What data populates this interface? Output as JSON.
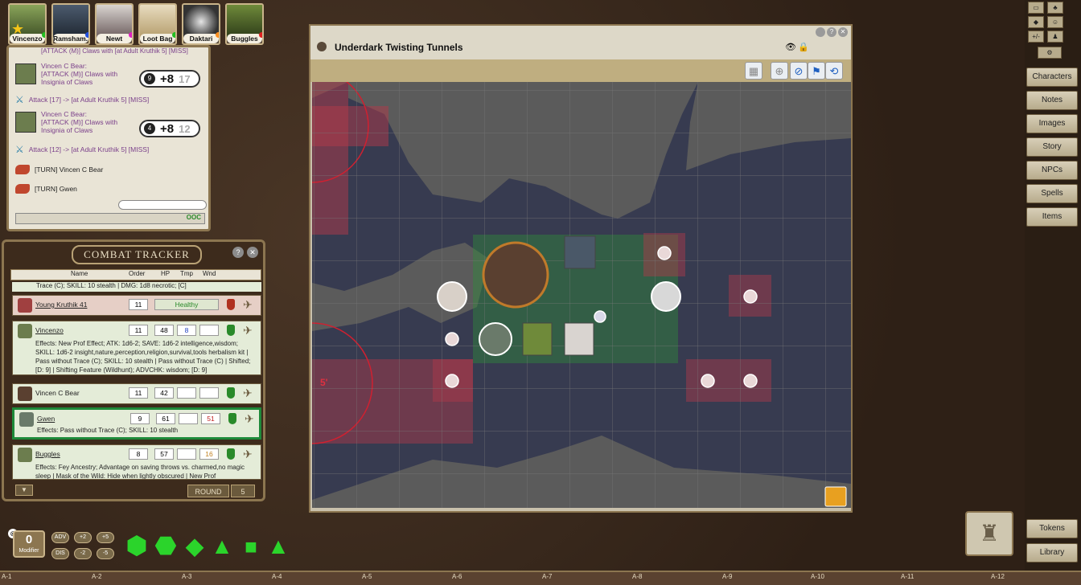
{
  "portraits": [
    {
      "name": "Vincenzo",
      "dot": "#22c022",
      "star": true
    },
    {
      "name": "Ramsham...",
      "dot": "#2050e0"
    },
    {
      "name": "Newt",
      "dot": "#e020c0"
    },
    {
      "name": "Loot Bag",
      "dot": "#22c022"
    },
    {
      "name": "Daktari",
      "dot": "#ff9020"
    },
    {
      "name": "Buggles",
      "dot": "#e02020"
    }
  ],
  "chat": {
    "top_partial": "[ATTACK (M)] Claws with [at Adult Kruthik 5] [MISS]",
    "entries": [
      {
        "type": "roll",
        "text1": "Vincen C Bear:",
        "text2": "[ATTACK (M)] Claws with",
        "text3": "Insignia of Claws",
        "die": "9",
        "total": "+8",
        "raw": "17"
      },
      {
        "type": "attack",
        "text": "Attack [17] -> [at Adult Kruthik 5] [MISS]"
      },
      {
        "type": "roll",
        "text1": "Vincen C Bear:",
        "text2": "[ATTACK (M)] Claws with",
        "text3": "Insignia of Claws",
        "die": "4",
        "total": "+8",
        "raw": "12"
      },
      {
        "type": "attack",
        "text": "Attack [12] -> [at Adult Kruthik 5] [MISS]"
      },
      {
        "type": "turn",
        "text": "[TURN] Vincen C Bear"
      },
      {
        "type": "turn",
        "text": "[TURN] Gwen"
      }
    ],
    "ooc": "OOC"
  },
  "combat_tracker": {
    "title": "COMBAT TRACKER",
    "headers": {
      "name": "Name",
      "order": "Order",
      "hp": "HP",
      "tmp": "Tmp",
      "wnd": "Wnd"
    },
    "top_partial": "Trace (C); SKILL: 10 stealth | DMG: 1d8 necrotic; [C]",
    "entries": [
      {
        "name": "Young Kruthik 41",
        "order": "11",
        "status": "Healthy",
        "bg": "#e6cfc6"
      },
      {
        "name": "Vincenzo",
        "order": "11",
        "hp": "48",
        "tmp": "8",
        "wnd": "",
        "bg": "#e4ecd8",
        "effects": "Effects: New Prof Effect; ATK: 1d6-2; SAVE: 1d6-2 intelligence,wisdom; SKILL: 1d6-2 insight,nature,perception,religion,survival,tools herbalism kit | Pass without Trace (C); SKILL: 10 stealth | Pass without Trace (C) | Shifted; [D: 9] | Shifting Feature (Wildhunt); ADVCHK: wisdom; [D: 9]"
      },
      {
        "name": "Vincen C Bear",
        "order": "11",
        "hp": "42",
        "tmp": "",
        "wnd": "",
        "bg": "#e4ecd8"
      },
      {
        "name": "Gwen",
        "order": "9",
        "hp": "61",
        "tmp": "",
        "wnd": "51",
        "bg": "#e4ecd8",
        "effects": "Effects: Pass without Trace (C); SKILL: 10 stealth"
      },
      {
        "name": "Buggles",
        "order": "8",
        "hp": "57",
        "tmp": "",
        "wnd": "16",
        "bg": "#e4ecd8",
        "effects": "Effects: Fey Ancestry; Advantage on saving throws vs. charmed,no magic sleep | Mask of the Wild: Hide when lightly obscured | New Prof"
      }
    ],
    "round_label": "ROUND",
    "round_value": "5"
  },
  "map": {
    "title": "Underdark Twisting Tunnels",
    "range_label": "5'"
  },
  "sidebar": {
    "top_buttons": [
      "+/-",
      "⚙"
    ],
    "buttons": [
      "Characters",
      "Notes",
      "Images",
      "Story",
      "NPCs",
      "Spells",
      "Items"
    ],
    "bottom_buttons": [
      "Tokens",
      "Library"
    ]
  },
  "modifier": {
    "value": "0",
    "label": "Modifier",
    "buttons": [
      "ADV",
      "+2",
      "+5",
      "DIS",
      "-2",
      "-5"
    ]
  },
  "dice": [
    "d20",
    "d12",
    "d10",
    "d8",
    "d6",
    "d4"
  ],
  "hotkeys": [
    "A-1",
    "A-2",
    "A-3",
    "A-4",
    "A-5",
    "A-6",
    "A-7",
    "A-8",
    "A-9",
    "A-10",
    "A-11",
    "A-12"
  ]
}
